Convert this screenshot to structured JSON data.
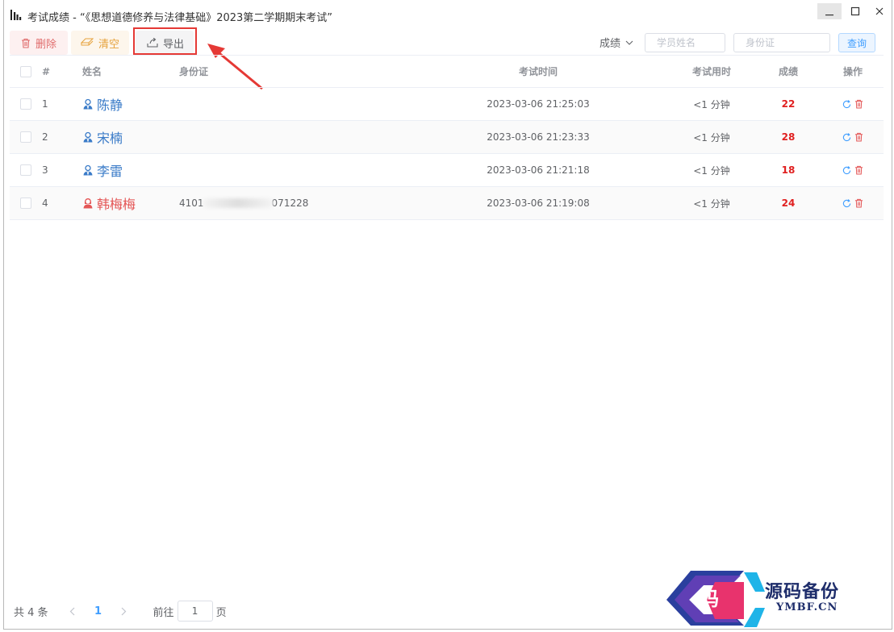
{
  "window": {
    "title": "考试成绩 - “《思想道德修养与法律基础》2023第二学期期末考试”"
  },
  "toolbar": {
    "delete_label": "删除",
    "clear_label": "清空",
    "export_label": "导出",
    "sort_label": "成绩",
    "name_placeholder": "学员姓名",
    "id_placeholder": "身份证",
    "query_label": "查询"
  },
  "table": {
    "headers": {
      "no": "#",
      "name": "姓名",
      "id": "身份证",
      "time": "考试时间",
      "duration": "考试用时",
      "score": "成绩",
      "ops": "操作"
    },
    "rows": [
      {
        "no": "1",
        "name": "陈静",
        "gender": "male",
        "id_prefix": "",
        "id_suffix": "",
        "time": "2023-03-06 21:25:03",
        "duration": "<1 分钟",
        "score": "22"
      },
      {
        "no": "2",
        "name": "宋楠",
        "gender": "male",
        "id_prefix": "",
        "id_suffix": "",
        "time": "2023-03-06 21:23:33",
        "duration": "<1 分钟",
        "score": "28"
      },
      {
        "no": "3",
        "name": "李雷",
        "gender": "male",
        "id_prefix": "",
        "id_suffix": "",
        "time": "2023-03-06 21:21:18",
        "duration": "<1 分钟",
        "score": "18"
      },
      {
        "no": "4",
        "name": "韩梅梅",
        "gender": "female",
        "id_prefix": "4101",
        "id_suffix": "071228",
        "time": "2023-03-06 21:19:08",
        "duration": "<1 分钟",
        "score": "24"
      }
    ]
  },
  "pagination": {
    "total": "共 4 条",
    "current_page": "1",
    "goto_label": "前往",
    "goto_value": "1",
    "page_suffix": "页"
  },
  "watermark": {
    "text": "源码备份",
    "sub": "YMBF.CN",
    "char": "码"
  },
  "colors": {
    "accent": "#409eff",
    "danger": "#e02020",
    "highlight": "#e53935",
    "male": "#3a7bc8",
    "female": "#e45656"
  },
  "icons": {
    "app": "bar-chart-icon",
    "delete": "trash-icon",
    "clear": "eraser-icon",
    "export": "upload-icon",
    "refresh": "refresh-icon",
    "remove": "trash-icon",
    "male": "male-user-icon",
    "female": "female-user-icon"
  }
}
